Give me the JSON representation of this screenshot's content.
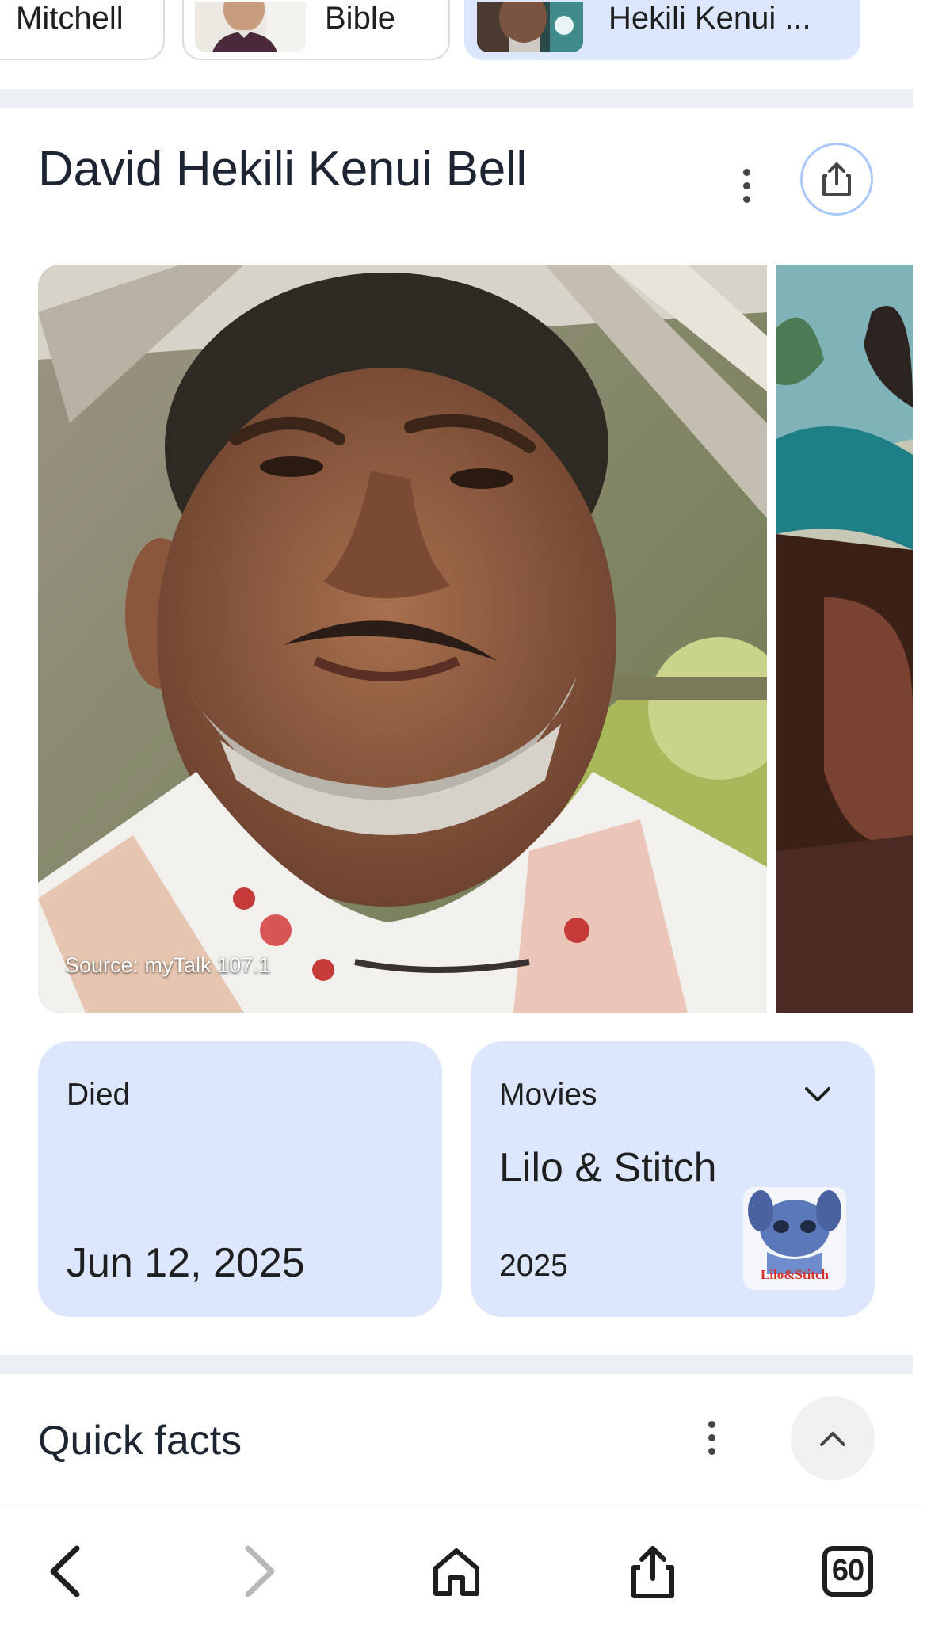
{
  "chips": [
    {
      "label": "Mitchell"
    },
    {
      "label": "Bible"
    },
    {
      "label": "Hekili Kenui ..."
    }
  ],
  "entity": {
    "title": "David Hekili Kenui Bell"
  },
  "image": {
    "source": "Source: myTalk 107.1"
  },
  "died_card": {
    "label": "Died",
    "value": "Jun 12, 2025"
  },
  "movies_card": {
    "label": "Movies",
    "title": "Lilo & Stitch",
    "year": "2025",
    "thumb_text": "Lilo & Stitch"
  },
  "quick_facts": {
    "title": "Quick facts"
  },
  "bottom_nav": {
    "tabs_count": "60"
  },
  "colors": {
    "selected_chip": "#dce6fd",
    "card_bg": "#dce6fd",
    "share_ring": "#a8c7fa",
    "divider": "#eceff3"
  }
}
